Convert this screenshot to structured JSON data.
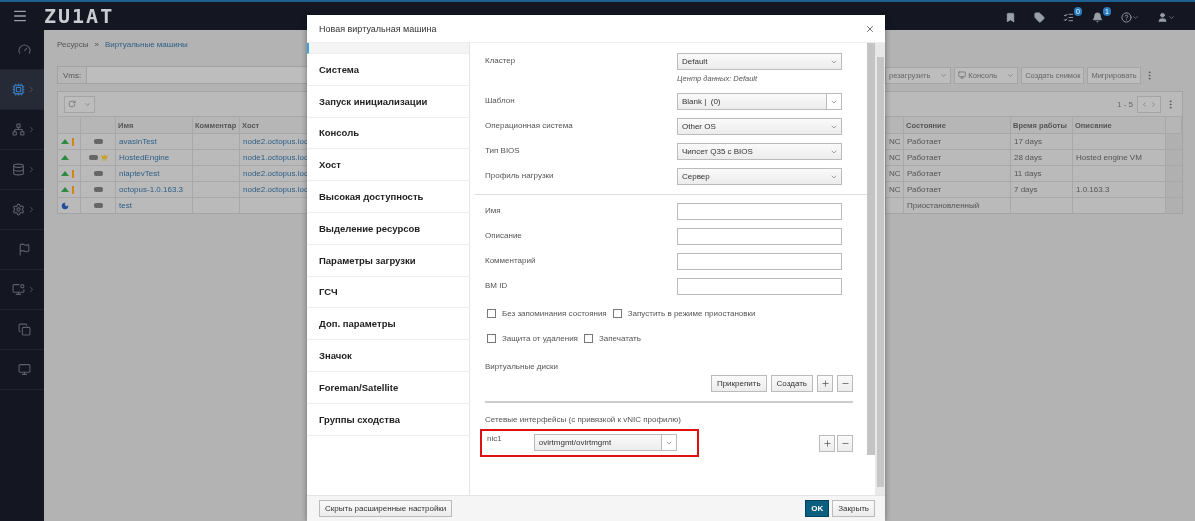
{
  "topbar": {
    "logo": "ZU1AT",
    "icons": [
      {
        "dropdown": false
      },
      {
        "dropdown": false
      },
      {
        "badge": "0",
        "dropdown": false
      },
      {
        "badge": "1",
        "dropdown": false
      },
      {
        "dropdown": true
      },
      {
        "dropdown": true
      }
    ]
  },
  "sidebar": {
    "items": [
      {
        "selected": false,
        "submenu": false
      },
      {
        "selected": true,
        "submenu": true
      },
      {
        "selected": false,
        "submenu": true
      },
      {
        "selected": false,
        "submenu": true
      },
      {
        "selected": false,
        "submenu": true
      },
      {
        "selected": false,
        "submenu": false
      },
      {
        "selected": false,
        "submenu": true
      },
      {
        "selected": false,
        "submenu": false
      },
      {
        "selected": false,
        "submenu": false
      }
    ]
  },
  "breadcrumb": {
    "items": [
      "Ресурсы",
      "Виртуальные машины"
    ],
    "separator": "»"
  },
  "search": {
    "label": "Vms:"
  },
  "actions": [
    {
      "label": "резагрузить",
      "dropdown": true,
      "with_icon": false
    },
    {
      "label": "Консоль",
      "dropdown": true,
      "with_icon": true
    },
    {
      "label": "Создать снимок",
      "dropdown": false,
      "with_icon": false
    },
    {
      "label": "Мигрировать",
      "dropdown": false,
      "with_icon": false
    }
  ],
  "table": {
    "pagination": "1 - 5",
    "columns": [
      "Имя",
      "Комментар",
      "Хост",
      "Состояние",
      "Время работы",
      "Описание"
    ],
    "rows": [
      {
        "paused": false,
        "warning": true,
        "hosted_engine": false,
        "name": "avasinTest",
        "host": "node2.octopus.loc",
        "console": "NC",
        "state": "Работает",
        "uptime": "17 days"
      },
      {
        "paused": false,
        "warning": false,
        "hosted_engine": true,
        "name": "HostedEngine",
        "host": "node1.octopus.loc",
        "console": "NC",
        "state": "Работает",
        "uptime": "28 days",
        "description": "Hosted engine VM"
      },
      {
        "paused": false,
        "warning": true,
        "hosted_engine": false,
        "name": "nlaptevTest",
        "host": "node2.octopus.loc",
        "console": "NC",
        "state": "Работает",
        "uptime": "11 days"
      },
      {
        "paused": false,
        "warning": true,
        "hosted_engine": false,
        "name": "octopus-1.0.163.3",
        "host": "node2.octopus.loc",
        "console": "NC",
        "state": "Работает",
        "uptime": "7 days",
        "description": "1.0.163.3"
      },
      {
        "paused": true,
        "warning": false,
        "hosted_engine": false,
        "name": "test",
        "state": "Приостановленный"
      }
    ]
  },
  "dialog": {
    "title": "Новая виртуальная машина",
    "nav": [
      "Система",
      "Запуск инициализации",
      "Консоль",
      "Хост",
      "Высокая доступность",
      "Выделение ресурсов",
      "Параметры загрузки",
      "ГСЧ",
      "Доп. параметры",
      "Значок",
      "Foreman/Satellite",
      "Группы сходства"
    ],
    "selects": [
      {
        "kind": "select",
        "label": "Кластер",
        "value": "Default",
        "hint": "Центр данных: Default"
      },
      {
        "kind": "split",
        "label": "Шаблон",
        "value": "Blank |  (0)"
      },
      {
        "kind": "select",
        "label": "Операционная система",
        "value": "Other OS"
      },
      {
        "kind": "select",
        "label": "Тип BIOS",
        "value": "Чипсет Q35 с BIOS"
      },
      {
        "kind": "select",
        "label": "Профиль нагрузки",
        "value": "Сервер"
      }
    ],
    "inputs": [
      {
        "label": "Имя"
      },
      {
        "label": "Описание"
      },
      {
        "label": "Комментарий"
      },
      {
        "label": "ВМ ID"
      }
    ],
    "checkbox_rows": [
      [
        {
          "label": "Без запоминания состояния",
          "checked": false
        },
        {
          "label": "Запустить в режиме приостановки",
          "checked": false
        }
      ],
      [
        {
          "label": "Защита от удаления",
          "checked": false
        },
        {
          "label": "Запечатать",
          "checked": false
        }
      ]
    ],
    "disks": {
      "label": "Виртуальные диски",
      "buttons": [
        "Прикрепить",
        "Создать"
      ]
    },
    "network": {
      "label": "Сетевые интерфейсы (с привязкой к vNIC профилю)",
      "nics": [
        {
          "name": "nic1",
          "value": "ovirtmgmt/ovirtmgmt",
          "highlighted": true
        }
      ]
    },
    "footer": {
      "advanced": "Скрыть расширенные настройки",
      "ok": "OK",
      "close": "Закрыть"
    }
  }
}
